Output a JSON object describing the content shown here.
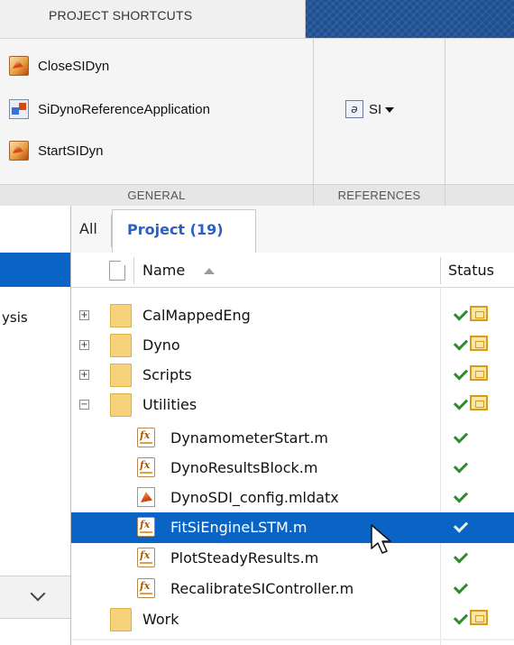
{
  "ribbon": {
    "tab_label": "PROJECT SHORTCUTS",
    "shortcuts": [
      {
        "label": "CloseSIDyn",
        "icon": "matlab-icon"
      },
      {
        "label": "SiDynoReferenceApplication",
        "icon": "simulink-icon"
      },
      {
        "label": "StartSIDyn",
        "icon": "matlab-icon"
      }
    ],
    "groups": {
      "general": "GENERAL",
      "references": "REFERENCES"
    },
    "reference_button": {
      "label": "SI",
      "icon": "reference-icon"
    }
  },
  "tabs": {
    "all": "All",
    "project": "Project (19)"
  },
  "table": {
    "headers": {
      "name": "Name",
      "status": "Status"
    },
    "rows": [
      {
        "name": "CalMappedEng",
        "type": "folder",
        "expander": "+",
        "status": "check-folder"
      },
      {
        "name": "Dyno",
        "type": "folder",
        "expander": "+",
        "status": "check-folder"
      },
      {
        "name": "Scripts",
        "type": "folder",
        "expander": "+",
        "status": "check-folder"
      },
      {
        "name": "Utilities",
        "type": "folder",
        "expander": "−",
        "status": "check-folder"
      },
      {
        "name": "DynamometerStart.m",
        "type": "m-file",
        "status": "check"
      },
      {
        "name": "DynoResultsBlock.m",
        "type": "m-file",
        "status": "check"
      },
      {
        "name": "DynoSDI_config.mldatx",
        "type": "mldatx-file",
        "status": "check"
      },
      {
        "name": "FitSiEngineLSTM.m",
        "type": "m-file",
        "status": "check",
        "selected": true
      },
      {
        "name": "PlotSteadyResults.m",
        "type": "m-file",
        "status": "check"
      },
      {
        "name": "RecalibrateSIController.m",
        "type": "m-file",
        "status": "check"
      },
      {
        "name": "Work",
        "type": "folder",
        "status": "check-folder"
      }
    ]
  },
  "left_panel": {
    "partial_label": "ysis"
  },
  "colors": {
    "selection": "#0a64c6",
    "accent_text": "#2c5fbf",
    "check": "#2e8b2e",
    "folder": "#f6d27a"
  }
}
